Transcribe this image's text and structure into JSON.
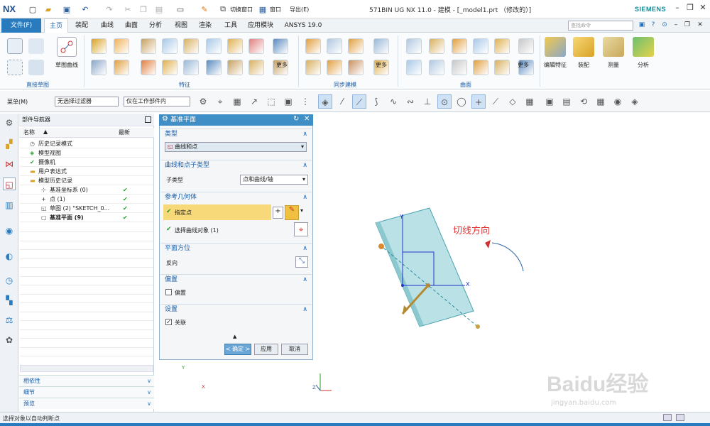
{
  "app": {
    "logo": "NX",
    "window_title": "571BIN UG NX 11.0 - 建模 - [_model1.prt （修改的）]",
    "brand": "SIEMENS"
  },
  "quickaccess": {
    "switch_window": "切换窗口",
    "window": "窗口",
    "export": "导出(E)"
  },
  "menu": {
    "file": "文件(F)",
    "tabs": [
      "主页",
      "装配",
      "曲线",
      "曲面",
      "分析",
      "视图",
      "渲染",
      "工具",
      "应用模块",
      "ANSYS 19.0"
    ],
    "search_placeholder": "查找命令"
  },
  "ribbon": {
    "groups": [
      "直接草图",
      "特征",
      "同步建模",
      "曲面"
    ],
    "sketch_curve": "草图曲线",
    "more": "更多",
    "edit_feature": "编辑特征",
    "assembly": "装配",
    "measure": "测量",
    "analysis": "分析"
  },
  "toolbar2": {
    "menu": "菜单(M)",
    "filter": "无选择过滤器",
    "scope": "仅在工作部件内"
  },
  "navigator": {
    "title": "部件导航器",
    "col_name": "名称",
    "col_latest": "最新",
    "rows": [
      {
        "label": "历史记录模式",
        "check": ""
      },
      {
        "label": "模型视图",
        "check": ""
      },
      {
        "label": "摄像机",
        "check": ""
      },
      {
        "label": "用户表达式",
        "check": ""
      },
      {
        "label": "模型历史记录",
        "check": ""
      },
      {
        "label": "基准坐标系 (0)",
        "check": "✔"
      },
      {
        "label": "点 (1)",
        "check": "✔"
      },
      {
        "label": "草图 (2) \"SKETCH_0...",
        "check": "✔"
      },
      {
        "label": "基准平面 (9)",
        "check": "✔"
      }
    ],
    "accordion": [
      "相依性",
      "细节",
      "预览"
    ]
  },
  "dialog": {
    "title": "基准平面",
    "type_section": "类型",
    "type_value": "曲线和点",
    "subtype_section": "曲线和点子类型",
    "subtype_label": "子类型",
    "subtype_value": "点和曲线/轴",
    "ref_section": "参考几何体",
    "specify_point": "指定点",
    "select_curve": "选择曲线对象 (1)",
    "orient_section": "平面方位",
    "reverse": "反向",
    "offset_section": "偏置",
    "offset_check": "偏置",
    "settings_section": "设置",
    "associative": "关联",
    "ok": "< 确定 >",
    "apply": "应用",
    "cancel": "取消"
  },
  "viewport": {
    "annotation": "切线方向",
    "axis_x": "X",
    "axis_y": "Y",
    "triad_x": "X",
    "triad_y": "Y",
    "triad_z": "Z",
    "watermark": "Baidu经验",
    "watermark_url": "jingyan.baidu.com"
  },
  "status": {
    "text": "选择对象以自动判断点"
  }
}
